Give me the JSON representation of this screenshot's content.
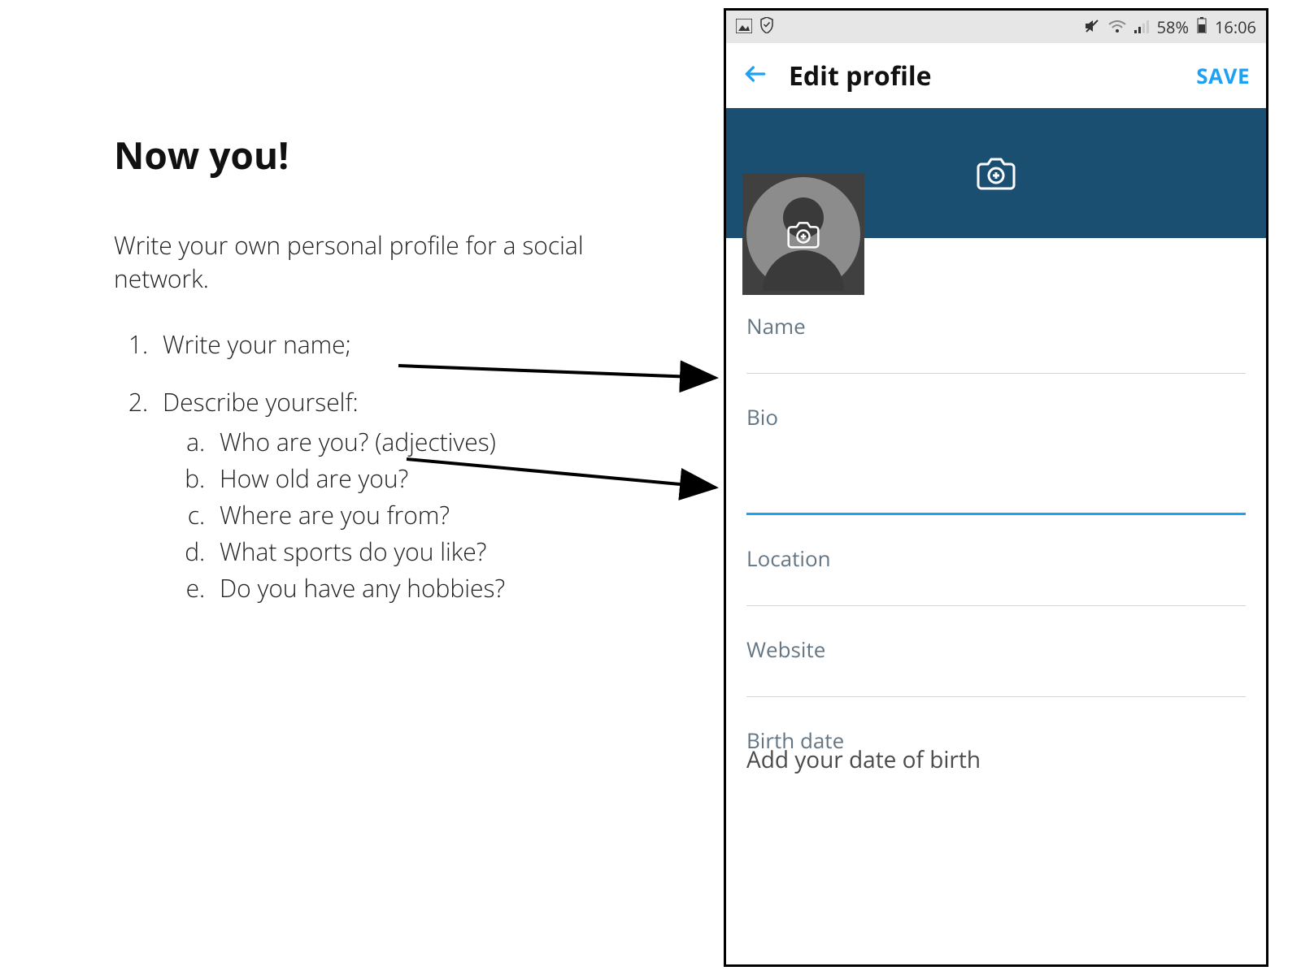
{
  "left": {
    "heading": "Now you!",
    "intro": "Write your own personal profile for a social network.",
    "item1": "Write your name;",
    "item2": "Describe yourself:",
    "sub_a": "Who are you? (adjectives)",
    "sub_b": "How old are you?",
    "sub_c": "Where are you from?",
    "sub_d": "What sports do you like?",
    "sub_e": "Do you have any hobbies?"
  },
  "phone": {
    "status": {
      "battery_pct": "58%",
      "time": "16:06"
    },
    "appbar": {
      "title": "Edit profile",
      "save": "SAVE"
    },
    "fields": {
      "name": "Name",
      "bio": "Bio",
      "location": "Location",
      "website": "Website",
      "birth_label": "Birth date",
      "birth_placeholder": "Add your date of birth"
    }
  },
  "colors": {
    "accent": "#1da1f2",
    "cover": "#1b4f72"
  }
}
